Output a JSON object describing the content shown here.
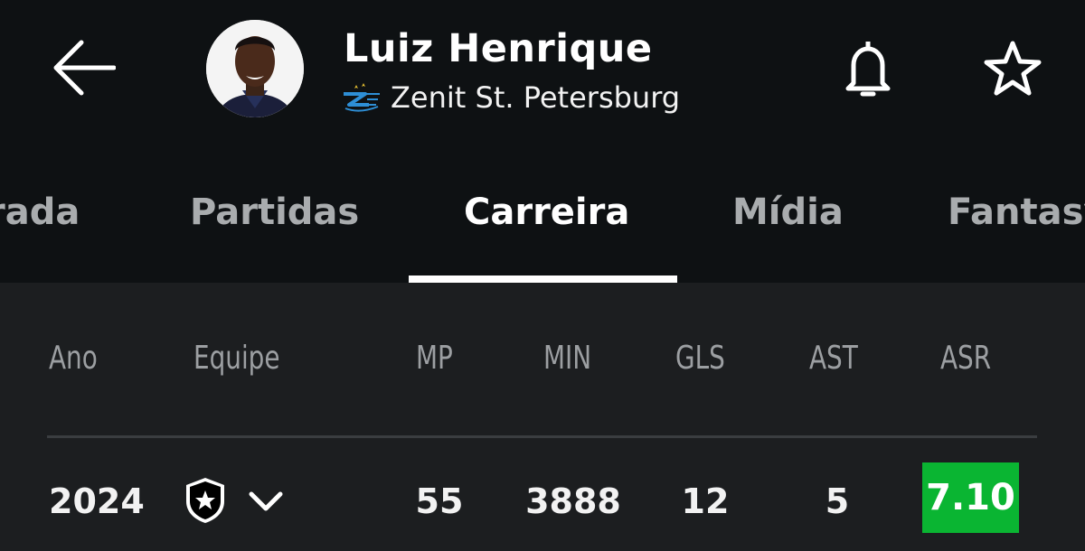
{
  "header": {
    "player_name": "Luiz Henrique",
    "club_name": "Zenit St. Petersburg",
    "icons": {
      "back": "arrow-left-icon",
      "notifications": "bell-icon",
      "favorite": "star-outline-icon"
    }
  },
  "tabs": [
    {
      "label": "rada",
      "active": false
    },
    {
      "label": "Partidas",
      "active": false
    },
    {
      "label": "Carreira",
      "active": true
    },
    {
      "label": "Mídia",
      "active": false
    },
    {
      "label": "Fantasy",
      "active": false
    }
  ],
  "career_table": {
    "columns": [
      "Ano",
      "Equipe",
      "MP",
      "MIN",
      "GLS",
      "AST",
      "ASR"
    ],
    "rows": [
      {
        "year": "2024",
        "team_icon": "botafogo-crest-icon",
        "mp": "55",
        "min": "3888",
        "gls": "12",
        "ast": "5",
        "asr": "7.10"
      }
    ]
  },
  "colors": {
    "header_bg": "#0e1113",
    "table_bg": "#1c1e20",
    "rating_good": "#0ab532",
    "muted_text": "#9c9fa2"
  }
}
